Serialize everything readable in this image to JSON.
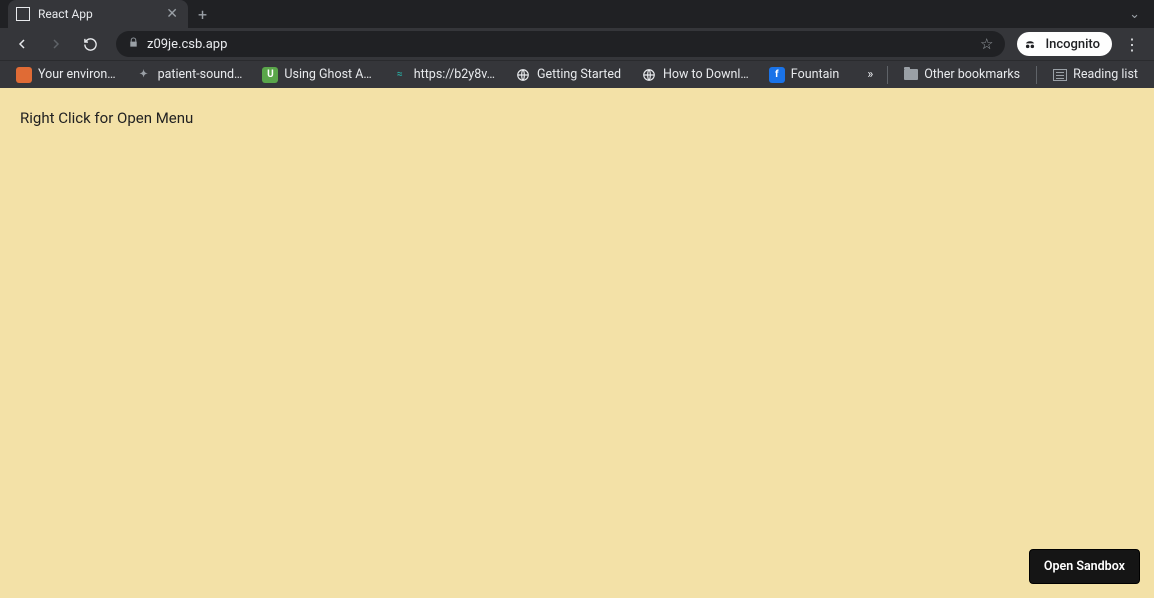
{
  "tab": {
    "title": "React App"
  },
  "toolbar": {
    "url": "z09je.csb.app",
    "incognito_label": "Incognito"
  },
  "bookmarks": {
    "items": [
      {
        "label": "Your environ…",
        "color": "#e06b35"
      },
      {
        "label": "patient-sound…",
        "color": "#9aa0a6"
      },
      {
        "label": "Using Ghost A…",
        "color": "#5aa64a"
      },
      {
        "label": "https://b2y8v…",
        "color": "#2aa198"
      },
      {
        "label": "Getting Started",
        "color": "#e8eaed",
        "globe": true
      },
      {
        "label": "How to Downl…",
        "color": "#e8eaed",
        "globe": true
      },
      {
        "label": "Fountain",
        "color": "#1a73e8",
        "letter": "f"
      }
    ],
    "other_label": "Other bookmarks",
    "reading_label": "Reading list"
  },
  "page": {
    "body_text": "Right Click for Open Menu",
    "sandbox_button": "Open Sandbox"
  }
}
